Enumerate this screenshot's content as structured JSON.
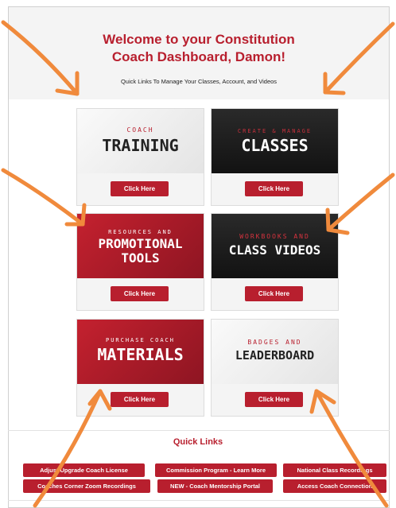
{
  "header": {
    "title_line1": "Welcome to your Constitution",
    "title_line2": "Coach Dashboard, Damon!",
    "subtitle": "Quick Links To Manage Your Classes, Account, and Videos"
  },
  "cards": [
    {
      "top": "COACH",
      "bottom": "TRAINING",
      "button": "Click Here"
    },
    {
      "top": "CREATE & MANAGE",
      "bottom": "CLASSES",
      "button": "Click Here"
    },
    {
      "top": "RESOURCES AND",
      "bottom": "PROMOTIONAL",
      "bottom2": "TOOLS",
      "button": "Click Here"
    },
    {
      "top": "WORKBOOKS AND",
      "bottom": "CLASS VIDEOS",
      "button": "Click Here"
    },
    {
      "top": "PURCHASE COACH",
      "bottom": "MATERIALS",
      "button": "Click Here"
    },
    {
      "top": "BADGES AND",
      "bottom": "LEADERBOARD",
      "button": "Click Here"
    }
  ],
  "quick_links": {
    "title": "Quick Links",
    "items": [
      "Adjust/Upgrade Coach License",
      "Commission Program - Learn More",
      "National Class Recordings",
      "Coaches Corner Zoom Recordings",
      "NEW - Coach Mentorship Portal",
      "Access Coach Connection"
    ]
  },
  "colors": {
    "brand": "#b81f2e",
    "arrow": "#f08a3c"
  }
}
